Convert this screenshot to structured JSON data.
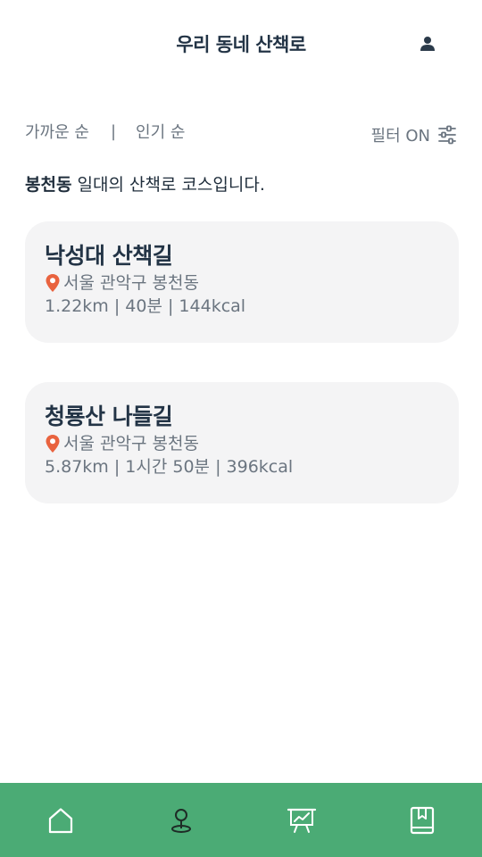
{
  "header": {
    "title": "우리 동네 산책로",
    "profile_icon": "user-icon"
  },
  "sort": {
    "tabs": [
      {
        "label": "가까운 순"
      },
      {
        "label": "인기 순"
      }
    ],
    "separator": "|",
    "filter_label": "필터 ON",
    "filter_icon": "sliders-icon"
  },
  "area": {
    "name": "봉천동",
    "suffix": " 일대의 산책로 코스입니다."
  },
  "courses": [
    {
      "title": "낙성대 산책길",
      "location": "서울 관악구 봉천동",
      "stats": "1.22km | 40분 | 144kcal"
    },
    {
      "title": "청룡산 나들길",
      "location": "서울 관악구 봉천동",
      "stats": "5.87km | 1시간 50분 | 396kcal"
    }
  ],
  "nav": {
    "items": [
      "home-icon",
      "location-person-icon",
      "chart-board-icon",
      "bookmark-book-icon"
    ]
  },
  "colors": {
    "accent": "#4bab75",
    "pin": "#e9633f",
    "card_bg": "#f4f4f5",
    "title_text": "#233446",
    "muted_text": "#6b7580"
  }
}
